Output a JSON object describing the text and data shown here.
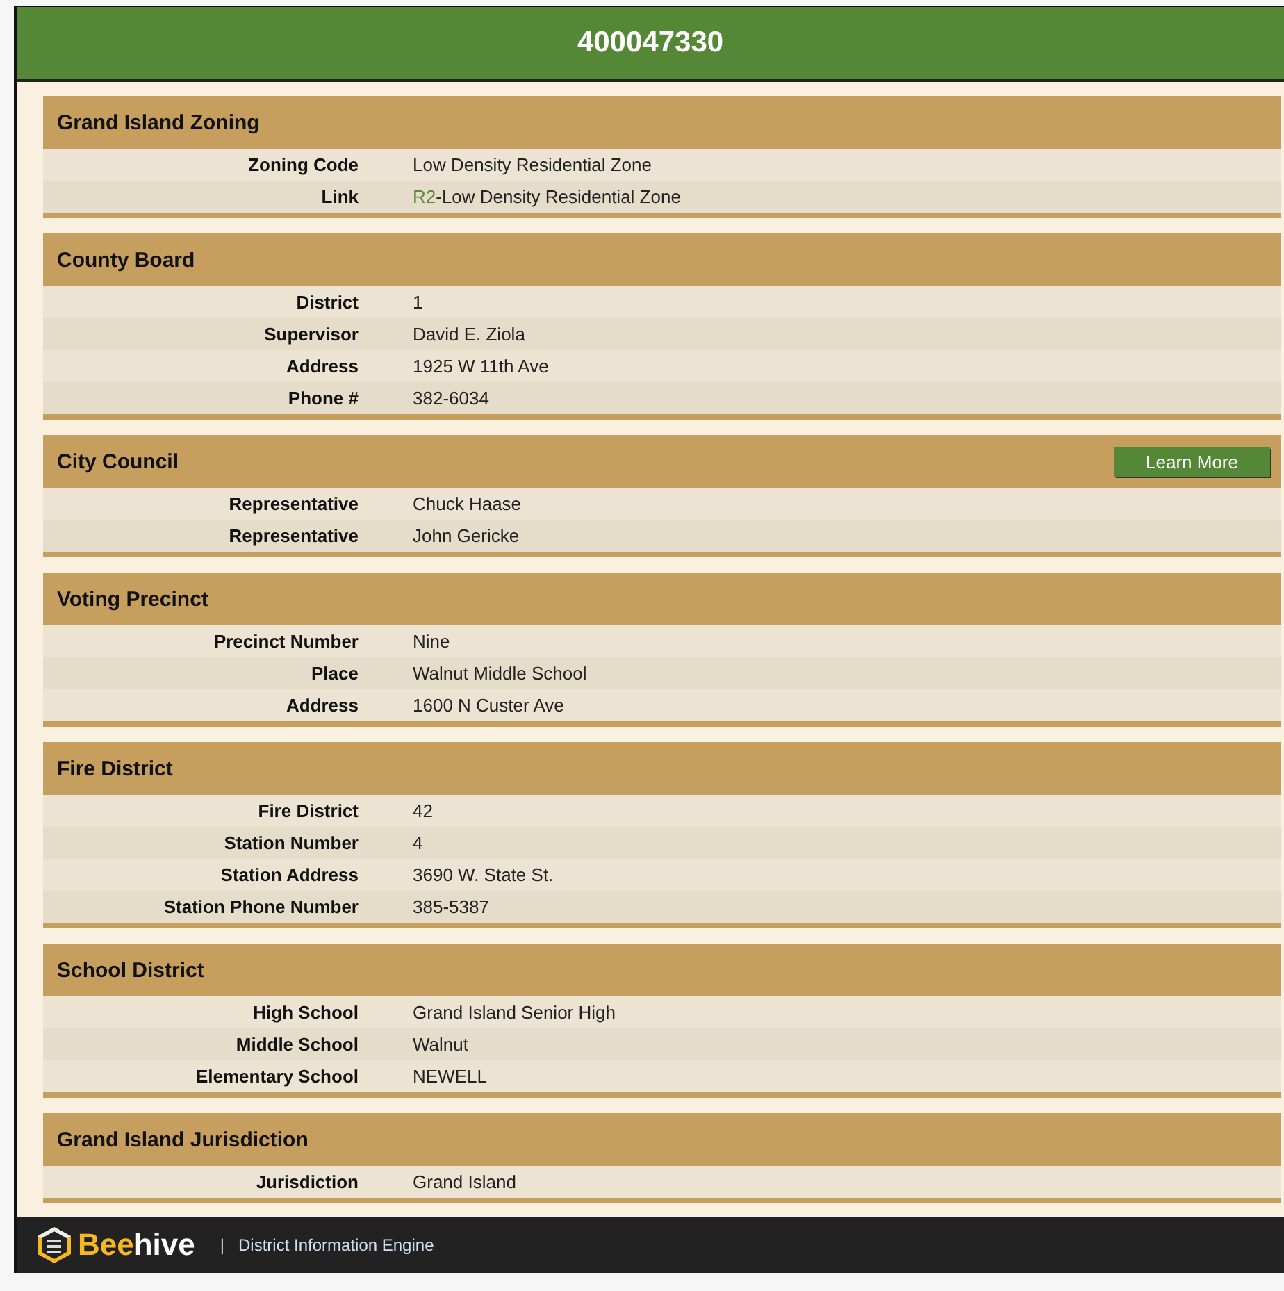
{
  "title": "400047330",
  "sections": [
    {
      "heading": "Grand Island Zoning",
      "rows": [
        {
          "label": "Zoning Code",
          "value": "Low Density Residential Zone"
        },
        {
          "label": "Link",
          "link": "R2",
          "value": "-Low Density Residential Zone"
        }
      ]
    },
    {
      "heading": "County Board",
      "rows": [
        {
          "label": "District",
          "value": "1"
        },
        {
          "label": "Supervisor",
          "value": "David E. Ziola"
        },
        {
          "label": "Address",
          "value": "1925 W 11th Ave"
        },
        {
          "label": "Phone #",
          "value": "382-6034"
        }
      ]
    },
    {
      "heading": "City Council",
      "button": "Learn More",
      "rows": [
        {
          "label": "Representative",
          "value": "Chuck Haase"
        },
        {
          "label": "Representative",
          "value": "John Gericke"
        }
      ]
    },
    {
      "heading": "Voting Precinct",
      "rows": [
        {
          "label": "Precinct Number",
          "value": "Nine"
        },
        {
          "label": "Place",
          "value": "Walnut Middle School"
        },
        {
          "label": "Address",
          "value": "1600 N Custer Ave"
        }
      ]
    },
    {
      "heading": "Fire District",
      "rows": [
        {
          "label": "Fire District",
          "value": "42"
        },
        {
          "label": "Station Number",
          "value": "4"
        },
        {
          "label": "Station Address",
          "value": "3690 W. State St."
        },
        {
          "label": "Station Phone Number",
          "value": "385-5387"
        }
      ]
    },
    {
      "heading": "School District",
      "rows": [
        {
          "label": "High School",
          "value": "Grand Island Senior High"
        },
        {
          "label": "Middle School",
          "value": "Walnut"
        },
        {
          "label": "Elementary School",
          "value": "NEWELL"
        }
      ]
    },
    {
      "heading": "Grand Island Jurisdiction",
      "rows": [
        {
          "label": "Jurisdiction",
          "value": "Grand Island"
        }
      ]
    }
  ],
  "footer": {
    "brand_highlight": "Bee",
    "brand_rest": "hive",
    "separator": "|",
    "tagline": "District Information Engine"
  }
}
